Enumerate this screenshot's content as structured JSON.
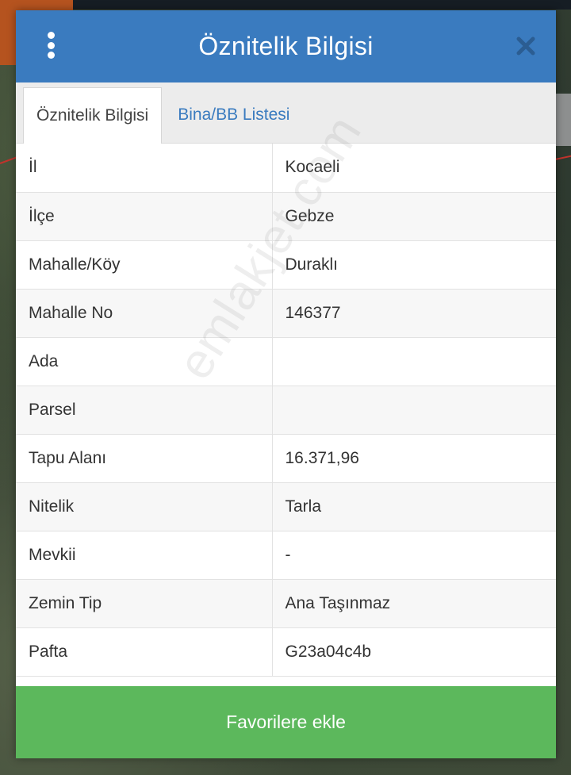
{
  "dialog": {
    "title": "Öznitelik Bilgisi",
    "menu_icon": "more-vertical-icon",
    "close_icon": "close-icon"
  },
  "tabs": [
    {
      "label": "Öznitelik Bilgisi",
      "active": true
    },
    {
      "label": "Bina/BB Listesi",
      "active": false
    }
  ],
  "rows": [
    {
      "label": "İl",
      "value": "Kocaeli"
    },
    {
      "label": "İlçe",
      "value": "Gebze"
    },
    {
      "label": "Mahalle/Köy",
      "value": "Duraklı"
    },
    {
      "label": "Mahalle No",
      "value": "146377"
    },
    {
      "label": "Ada",
      "value": ""
    },
    {
      "label": "Parsel",
      "value": ""
    },
    {
      "label": "Tapu Alanı",
      "value": "16.371,96"
    },
    {
      "label": "Nitelik",
      "value": "Tarla"
    },
    {
      "label": "Mevkii",
      "value": "-"
    },
    {
      "label": "Zemin Tip",
      "value": "Ana Taşınmaz"
    },
    {
      "label": "Pafta",
      "value": "G23a04c4b"
    }
  ],
  "watermark": "emlakjet.com",
  "favorite_button": {
    "label": "Favorilere ekle"
  },
  "colors": {
    "header": "#3a7bbf",
    "button": "#5cb85c",
    "tab_link": "#3a7bbf"
  }
}
